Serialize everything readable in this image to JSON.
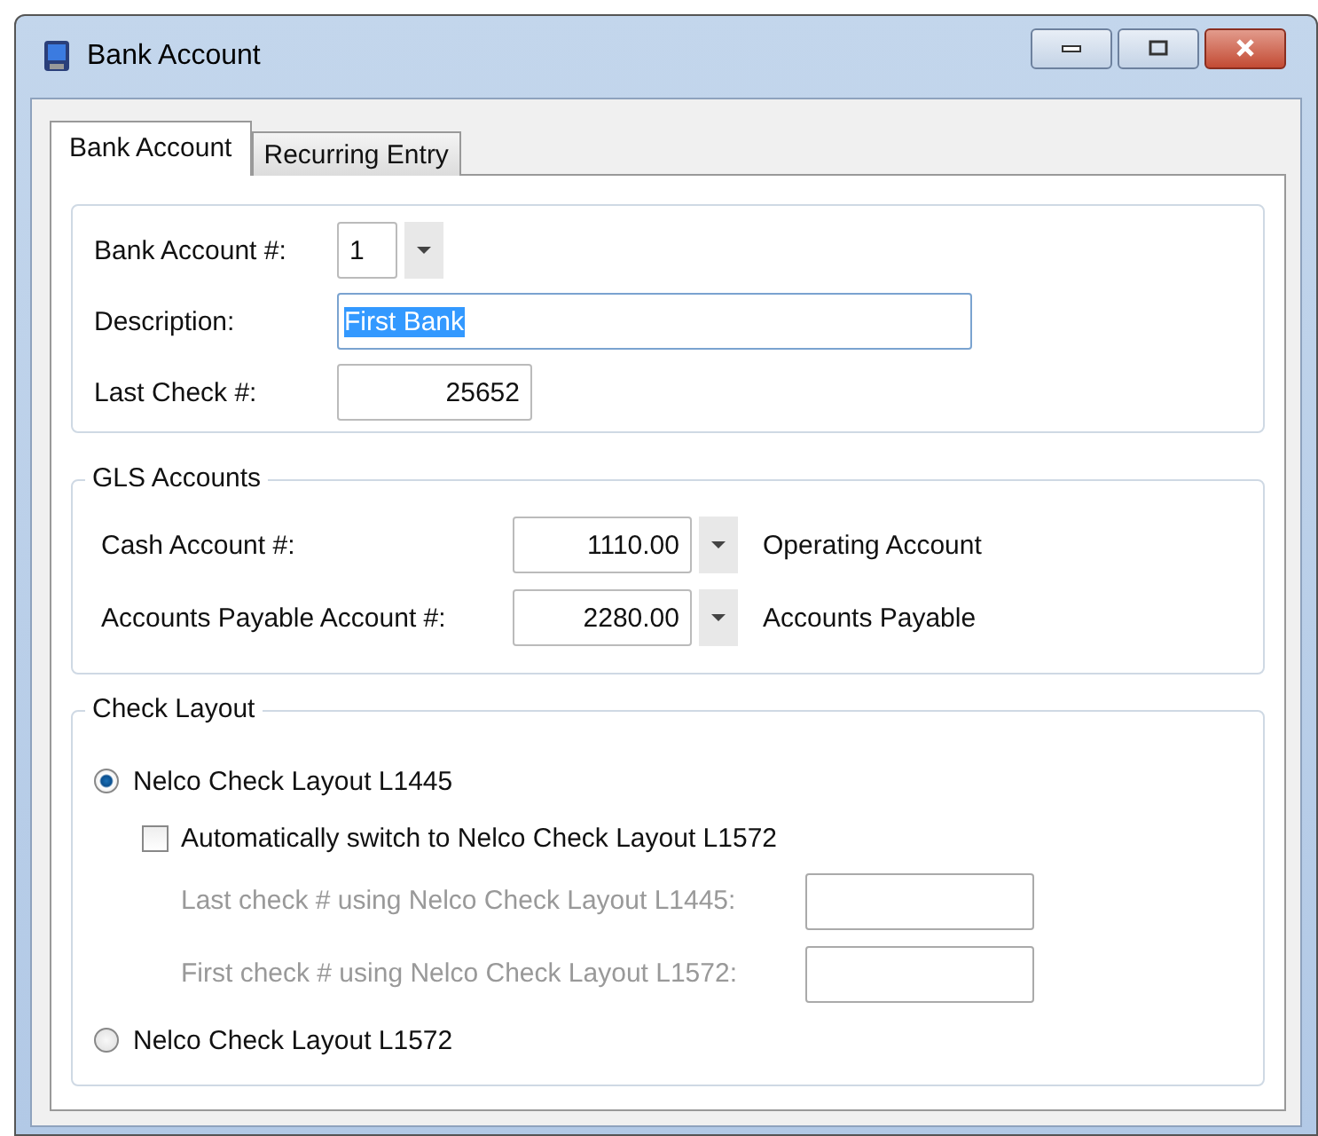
{
  "window": {
    "title": "Bank Account"
  },
  "tabs": [
    {
      "label": "Bank Account",
      "selected": true
    },
    {
      "label": "Recurring Entry",
      "selected": false
    }
  ],
  "bank": {
    "account_label": "Bank Account #:",
    "account_value": "1",
    "description_label": "Description:",
    "description_value": "First Bank",
    "description_selected": true,
    "last_check_label": "Last Check #:",
    "last_check_value": "25652"
  },
  "gls_accounts": {
    "title": "GLS Accounts",
    "rows": [
      {
        "label": "Cash Account #:",
        "value": "1110.00",
        "name": "Operating Account"
      },
      {
        "label": "Accounts Payable Account #:",
        "value": "2280.00",
        "name": "Accounts Payable"
      }
    ]
  },
  "check_layout": {
    "title": "Check Layout",
    "option_1": {
      "label": "Nelco Check Layout L1445",
      "selected": true
    },
    "auto_switch": {
      "label": "Automatically switch to Nelco Check Layout L1572",
      "checked": false
    },
    "fields": [
      {
        "label": "Last check # using Nelco Check Layout L1445:",
        "disabled": true
      },
      {
        "label": "First check # using Nelco Check Layout L1572:",
        "disabled": true
      }
    ],
    "option_2": {
      "label": "Nelco Check Layout L1572",
      "selected": false
    }
  }
}
